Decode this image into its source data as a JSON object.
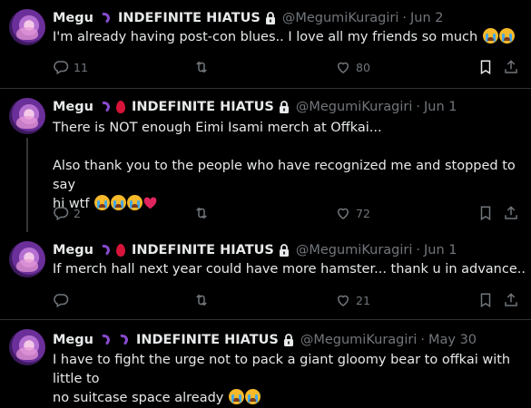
{
  "tweets": [
    {
      "name": "Megu",
      "status": "INDEFINITE HIATUS",
      "handle": "@MegumiKuragiri",
      "date": "Jun 2",
      "text": "I'm already having post-con blues.. I love all my friends so much",
      "text_emojis": [
        "sob",
        "sob"
      ],
      "replies": "11",
      "retweets": "",
      "likes": "80",
      "drop": false
    },
    {
      "name": "Megu",
      "status": "INDEFINITE HIATUS",
      "handle": "@MegumiKuragiri",
      "date": "Jun 1",
      "text_line1": "There is NOT enough Eimi Isami merch at Offkai...",
      "text_line2": "Also thank you to the people who have recognized me and stopped to say",
      "text_line3": "hi wtf",
      "text_emojis": [
        "sob",
        "sob",
        "sob",
        "red-heart"
      ],
      "replies": "2",
      "retweets": "",
      "likes": "72",
      "drop": true
    },
    {
      "name": "Megu",
      "status": "INDEFINITE HIATUS",
      "handle": "@MegumiKuragiri",
      "date": "Jun 1",
      "text": "If merch hall next year could have more hamster... thank u in advance..",
      "replies": "",
      "retweets": "",
      "likes": "21",
      "drop": true
    },
    {
      "name": "Megu",
      "status": "INDEFINITE HIATUS",
      "handle": "@MegumiKuragiri",
      "date": "May 30",
      "text_line1": "I have to fight the urge not to pack a giant gloomy bear to offkai with little to",
      "text_line2": "no suitcase space already",
      "text_emojis": [
        "sob",
        "sob"
      ],
      "drop": false
    }
  ],
  "icons": [
    "reply-icon",
    "retweet-icon",
    "like-icon",
    "bookmark-icon",
    "share-icon",
    "lock-icon",
    "worm-emoji",
    "blood-drop-emoji",
    "sob-emoji",
    "red-heart-emoji"
  ],
  "colors": {
    "background": "#000000",
    "text": "#e7e9ea",
    "muted": "#71767b",
    "divider": "#2f3336"
  }
}
